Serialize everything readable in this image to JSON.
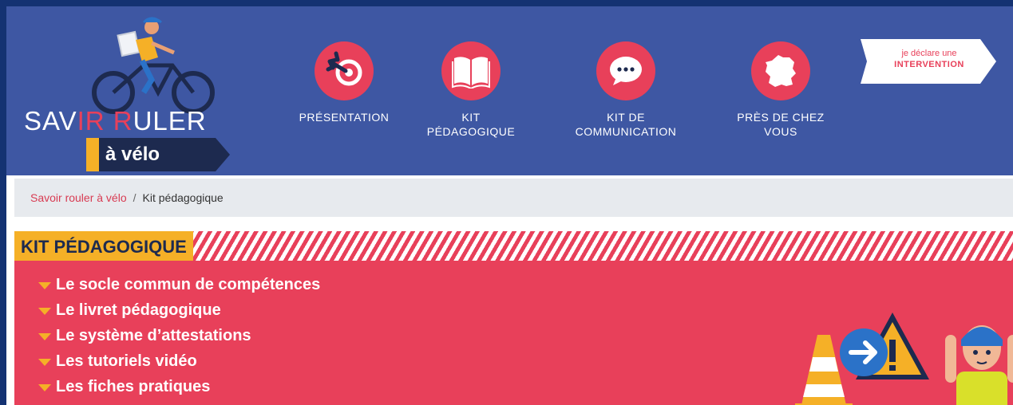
{
  "colors": {
    "page_border": "#143272",
    "header_bg": "#3e57a3",
    "accent_red": "#e8405a",
    "accent_yellow": "#f5b027",
    "navy": "#1d2a4f",
    "breadcrumb_bg": "#e7eaee"
  },
  "logo": {
    "line1_a": "SAV",
    "line1_b": "IR R",
    "line1_c": "ULER",
    "badge": "à vélo"
  },
  "nav": [
    {
      "icon": "target-arrow-icon",
      "label": "PRÉSENTATION"
    },
    {
      "icon": "open-book-icon",
      "label": "KIT\nPÉDAGOGIQUE"
    },
    {
      "icon": "speech-bubble-icon",
      "label": "KIT DE\nCOMMUNICATION"
    },
    {
      "icon": "france-map-icon",
      "label": "PRÈS DE CHEZ\nVOUS"
    }
  ],
  "cta": {
    "line1": "je déclare une",
    "line2": "INTERVENTION"
  },
  "breadcrumb": {
    "home": "Savoir rouler à vélo",
    "separator": "/",
    "current": "Kit pédagogique"
  },
  "kit": {
    "title": "KIT PÉDAGOGIQUE",
    "items": [
      "Le socle commun de compétences",
      "Le livret pédagogique",
      "Le système d’attestations",
      "Les tutoriels vidéo",
      "Les fiches pratiques"
    ]
  }
}
